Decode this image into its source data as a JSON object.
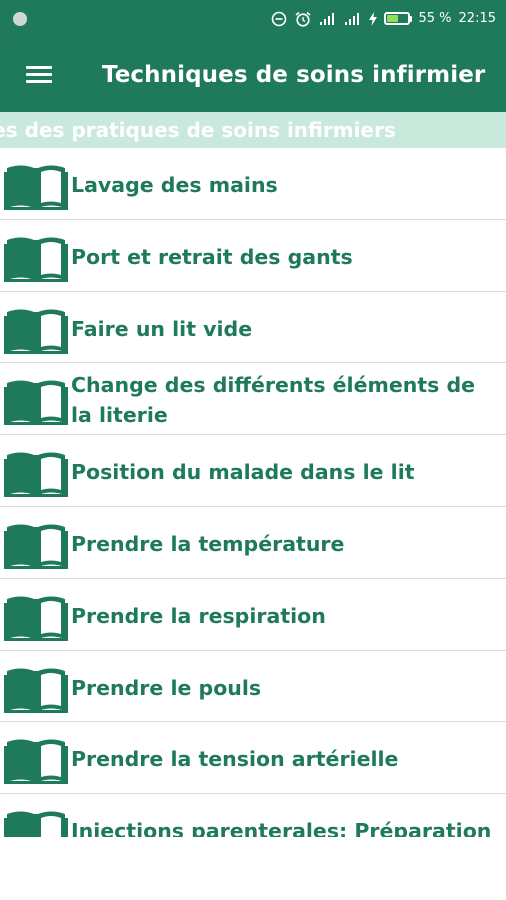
{
  "status_bar": {
    "battery_percent_text": "55 %",
    "battery_level": 0.55,
    "time": "22:15",
    "icons": [
      "circle-dot-icon",
      "minus-circle-icon",
      "alarm-icon",
      "signal-icon",
      "signal-icon",
      "charging-icon",
      "battery-icon"
    ]
  },
  "app_bar": {
    "menu_icon": "hamburger-menu-icon",
    "title": "Techniques de soins infirmier"
  },
  "marquee": {
    "text": "ues des pratiques de soins infirmiers"
  },
  "list": {
    "icon": "open-book-icon",
    "items": [
      {
        "label": "Lavage des mains"
      },
      {
        "label": "Port et retrait des gants"
      },
      {
        "label": "Faire un lit vide"
      },
      {
        "label": "Change des différents éléments de la literie"
      },
      {
        "label": "Position du malade dans le lit"
      },
      {
        "label": "Prendre la température"
      },
      {
        "label": "Prendre la respiration"
      },
      {
        "label": "Prendre le pouls"
      },
      {
        "label": "Prendre la tension artérielle"
      },
      {
        "label": "Injections parenterales: Préparation"
      }
    ]
  },
  "colors": {
    "primary": "#1f7a5c",
    "marquee_bg": "#c9e9dc",
    "text_on_primary": "#ffffff",
    "divider": "#dcdcdc",
    "battery_fill": "#8ee05a"
  }
}
